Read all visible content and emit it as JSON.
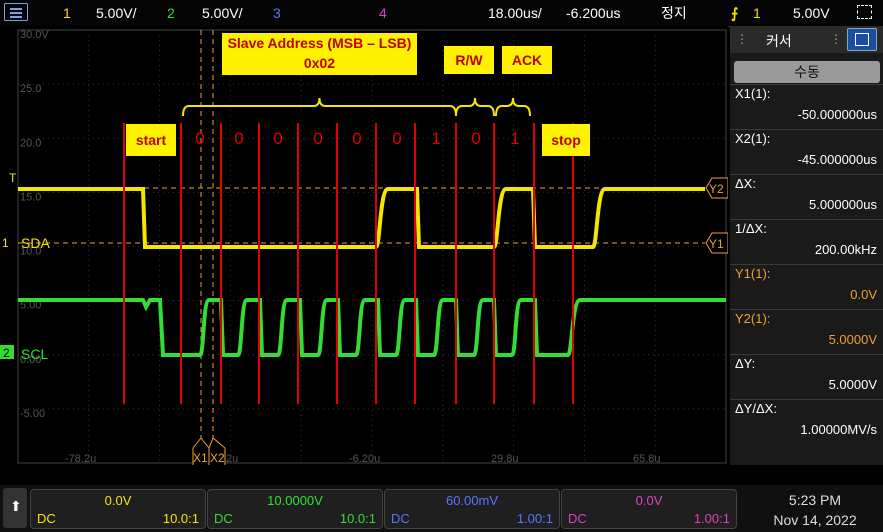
{
  "topbar": {
    "ch1_num": "1",
    "ch1_scale": "5.00V/",
    "ch2_num": "2",
    "ch2_scale": "5.00V/",
    "ch3_num": "3",
    "ch4_num": "4",
    "timebase": "18.00us/",
    "delay": "-6.200us",
    "run_state": "정지",
    "trig_icon": "trigger-slope-icon",
    "trig_channel": "1",
    "trig_level": "5.00V"
  },
  "grid": {
    "ylabels": [
      "30.0V",
      "25.0",
      "20.0",
      "15.0",
      "10.0",
      "5.00",
      "0.00",
      "-5.00"
    ],
    "xlabels": [
      "-78.2u",
      "-42.2u",
      "-6.20u",
      "29.8u",
      "65.8u"
    ]
  },
  "traces": {
    "sda_label": "SDA",
    "scl_label": "SCL",
    "ch1_marker": "1",
    "ch2_marker": "2",
    "trig_marker": "T",
    "y1_label": "Y1",
    "y2_label": "Y2",
    "x1_label": "X1",
    "x2_label": "X2"
  },
  "annotations": {
    "address_title": "Slave Address (MSB – LSB)",
    "address_value": "0x02",
    "rw": "R/W",
    "ack": "ACK",
    "start": "start",
    "stop": "stop",
    "bits": [
      "0",
      "0",
      "0",
      "0",
      "0",
      "0",
      "1",
      "0",
      "0",
      "1"
    ]
  },
  "panel": {
    "title": "커서",
    "mode_button": "수동",
    "rows": [
      {
        "label": "X1(1):",
        "value": "-50.000000us",
        "color": "#ffffff"
      },
      {
        "label": "X2(1):",
        "value": "-45.000000us",
        "color": "#ffffff"
      },
      {
        "label": "ΔX:",
        "value": "5.000000us",
        "color": "#ffffff"
      },
      {
        "label": "1/ΔX:",
        "value": "200.00kHz",
        "color": "#ffffff"
      },
      {
        "label": "Y1(1):",
        "value": "0.0V",
        "color": "#f0a030"
      },
      {
        "label": "Y2(1):",
        "value": "5.0000V",
        "color": "#f0a030"
      },
      {
        "label": "ΔY:",
        "value": "5.0000V",
        "color": "#ffffff"
      },
      {
        "label": "ΔY/ΔX:",
        "value": "1.00000MV/s",
        "color": "#ffffff"
      }
    ]
  },
  "channels": [
    {
      "value": "0.0V",
      "coupling": "DC",
      "probe": "10.0:1",
      "color": "#f5e600"
    },
    {
      "value": "10.0000V",
      "coupling": "DC",
      "probe": "10.0:1",
      "color": "#33dd33"
    },
    {
      "value": "60.00mV",
      "coupling": "DC",
      "probe": "1.00:1",
      "color": "#5577ff"
    },
    {
      "value": "0.0V",
      "coupling": "DC",
      "probe": "1.00:1",
      "color": "#e040c0"
    }
  ],
  "clock": {
    "time": "5:23 PM",
    "date": "Nov 14, 2022"
  },
  "colors": {
    "ch1": "#f5e600",
    "ch2": "#33dd33",
    "ch3": "#5577ff",
    "ch4": "#e040c0",
    "cursor": "#f0a030",
    "annotation_line": "#e00000"
  }
}
